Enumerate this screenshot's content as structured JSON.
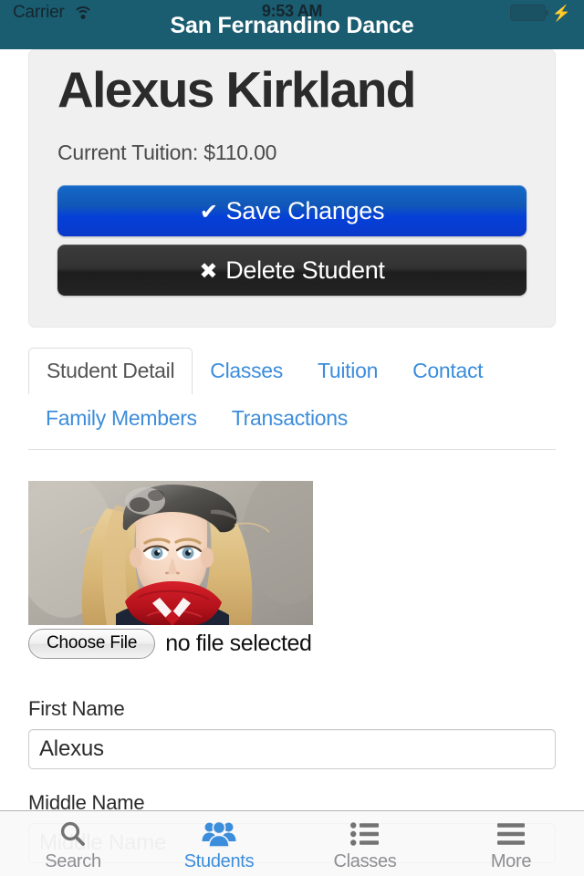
{
  "status_bar": {
    "carrier": "Carrier",
    "wifi_icon": "wifi-icon",
    "time": "9:53 AM",
    "battery_icon": "battery-icon",
    "charging_icon": "⚡",
    "battery_color": "#4cd964"
  },
  "header": {
    "title": "San Fernandino Dance",
    "background_color": "#1a5c70",
    "title_color": "#ffffff"
  },
  "jumbotron": {
    "student_name": "Alexus Kirkland",
    "tuition_line": "Current Tuition: $110.00",
    "background_color": "#f0f0f0",
    "save_button": {
      "label": "Save Changes",
      "glyph": "✔",
      "color": "#0a46cd"
    },
    "delete_button": {
      "label": "Delete Student",
      "glyph": "✖",
      "color": "#2b2b2b"
    }
  },
  "detail_tabs": {
    "link_color": "#3c8ddc",
    "row1": [
      {
        "label": "Student Detail",
        "active": true
      },
      {
        "label": "Classes",
        "active": false
      },
      {
        "label": "Tuition",
        "active": false
      },
      {
        "label": "Contact",
        "active": false
      }
    ],
    "row2": [
      {
        "label": "Family Members",
        "active": false
      },
      {
        "label": "Transactions",
        "active": false
      }
    ]
  },
  "photo_block": {
    "photo_alt": "student-portrait",
    "choose_file_label": "Choose File",
    "no_file_label": "no file selected"
  },
  "form": {
    "fields": [
      {
        "label": "First Name",
        "value": "Alexus",
        "placeholder": "First Name"
      },
      {
        "label": "Middle Name",
        "value": "",
        "placeholder": "Middle Name"
      }
    ]
  },
  "bottom_tabs": [
    {
      "label": "Search",
      "icon": "search-icon",
      "active": false
    },
    {
      "label": "Students",
      "icon": "people-icon",
      "active": true
    },
    {
      "label": "Classes",
      "icon": "list-icon",
      "active": false
    },
    {
      "label": "More",
      "icon": "hamburger-icon",
      "active": false
    }
  ]
}
